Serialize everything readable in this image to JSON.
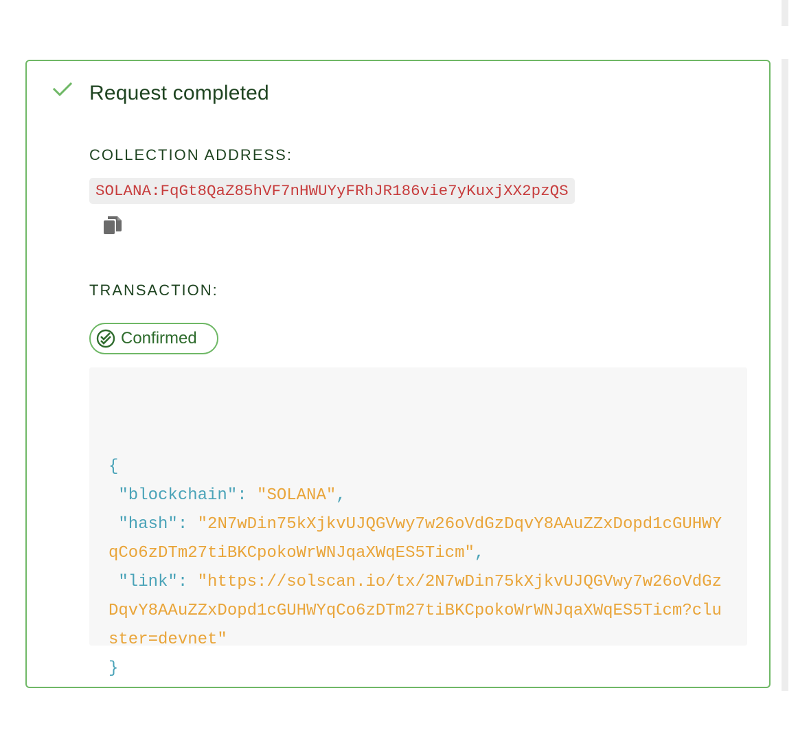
{
  "result": {
    "title": "Request completed",
    "status_icon": "check-icon",
    "accent_color": "#6fb866"
  },
  "collection": {
    "label": "COLLECTION ADDRESS:",
    "address": "SOLANA:FqGt8QaZ85hVF7nHWUYyFRhJR186vie7yKuxjXX2pzQS",
    "copy_icon": "copy-icon"
  },
  "transaction": {
    "label": "TRANSACTION:",
    "status": "Confirmed",
    "status_icon": "double-check-icon",
    "json": {
      "open_brace": "{",
      "close_brace": "}",
      "fields": [
        {
          "key": "\"blockchain\"",
          "value": "\"SOLANA\"",
          "trailing": ","
        },
        {
          "key": "\"hash\"",
          "value": "\"2N7wDin75kXjkvUJQGVwy7w26oVdGzDqvY8AAuZZxDopd1cGUHWYqCo6zDTm27tiBKCpokoWrWNJqaXWqES5Ticm\"",
          "trailing": ","
        },
        {
          "key": "\"link\"",
          "value": "\"https://solscan.io/tx/2N7wDin75kXjkvUJQGVwy7w26oVdGzDqvY8AAuZZxDopd1cGUHWYqCo6zDTm27tiBKCpokoWrWNJqaXWqES5Ticm?cluster=devnet\"",
          "trailing": ""
        }
      ]
    }
  }
}
